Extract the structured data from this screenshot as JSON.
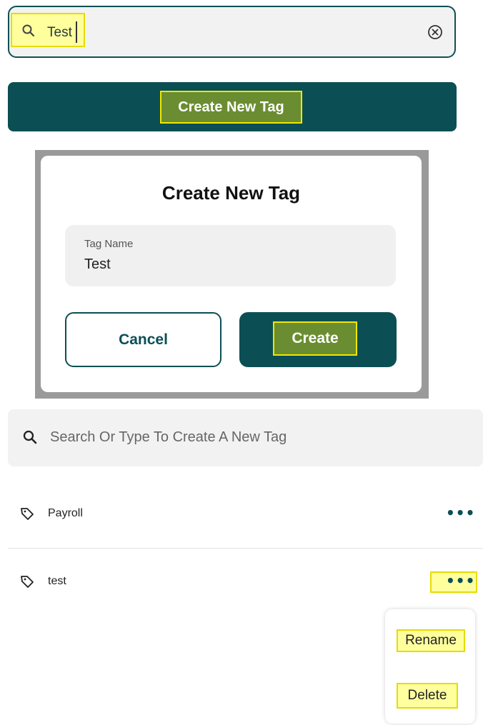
{
  "top_search": {
    "value": "Test"
  },
  "create_bar": {
    "label": "Create New Tag"
  },
  "modal": {
    "title": "Create New Tag",
    "field_label": "Tag Name",
    "field_value": "Test",
    "cancel_label": "Cancel",
    "create_label": "Create"
  },
  "tag_search": {
    "placeholder": "Search Or Type To Create A New Tag"
  },
  "tags": [
    {
      "label": "Payroll",
      "more": "•••"
    },
    {
      "label": "test",
      "more": "•••"
    }
  ],
  "context_menu": {
    "items": [
      "Rename",
      "Delete"
    ]
  },
  "colors": {
    "primary": "#0b4f54",
    "highlight_fill": "#ffff9e",
    "highlight_border": "#e6dc00",
    "button_highlight": "#6b8d31"
  }
}
